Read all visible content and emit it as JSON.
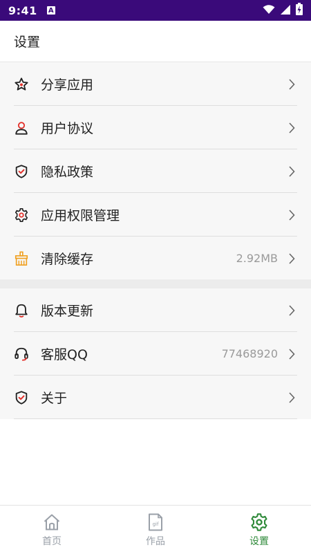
{
  "status_bar": {
    "time": "9:41",
    "notification_badge": "A"
  },
  "header": {
    "title": "设置"
  },
  "colors": {
    "status_bar_bg": "#3a0a7a",
    "icon_red": "#e3332d",
    "icon_orange": "#f0a020",
    "active_tab": "#2f8a3a",
    "inactive_tab": "#9aa0a8"
  },
  "settings": {
    "group1": [
      {
        "icon": "star-icon",
        "label": "分享应用",
        "value": ""
      },
      {
        "icon": "user-icon",
        "label": "用户协议",
        "value": ""
      },
      {
        "icon": "shield-icon",
        "label": "隐私政策",
        "value": ""
      },
      {
        "icon": "gear-icon",
        "label": "应用权限管理",
        "value": ""
      },
      {
        "icon": "broom-icon",
        "label": "清除缓存",
        "value": "2.92MB"
      }
    ],
    "group2": [
      {
        "icon": "bell-icon",
        "label": "版本更新",
        "value": ""
      },
      {
        "icon": "headset-icon",
        "label": "客服QQ",
        "value": "77468920"
      },
      {
        "icon": "shield-icon",
        "label": "关于",
        "value": ""
      }
    ]
  },
  "tabs": [
    {
      "label": "首页",
      "icon": "home-icon",
      "active": false
    },
    {
      "label": "作品",
      "icon": "gif-file-icon",
      "active": false
    },
    {
      "label": "设置",
      "icon": "gear-icon",
      "active": true
    }
  ]
}
